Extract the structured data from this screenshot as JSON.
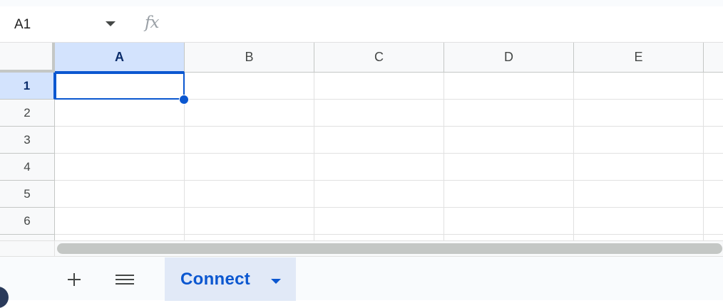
{
  "formula_bar": {
    "name_box_value": "A1",
    "fx_label": "fx",
    "formula_value": ""
  },
  "grid": {
    "columns": [
      "A",
      "B",
      "C",
      "D",
      "E"
    ],
    "rows": [
      "1",
      "2",
      "3",
      "4",
      "5",
      "6"
    ],
    "selected_cell": "A1",
    "cells": [
      [
        "",
        "",
        "",
        "",
        ""
      ],
      [
        "",
        "",
        "",
        "",
        ""
      ],
      [
        "",
        "",
        "",
        "",
        ""
      ],
      [
        "",
        "",
        "",
        "",
        ""
      ],
      [
        "",
        "",
        "",
        "",
        ""
      ],
      [
        "",
        "",
        "",
        "",
        ""
      ]
    ]
  },
  "sheet_bar": {
    "add_sheet_icon": "plus-icon",
    "all_sheets_icon": "menu-icon",
    "tabs": [
      {
        "label": "Connect",
        "active": true,
        "icon": "caret-down-icon"
      }
    ]
  },
  "colors": {
    "accent": "#0b57d0",
    "header_selected_bg": "#d3e3fd",
    "tab_active_bg": "#e1e9f7"
  }
}
